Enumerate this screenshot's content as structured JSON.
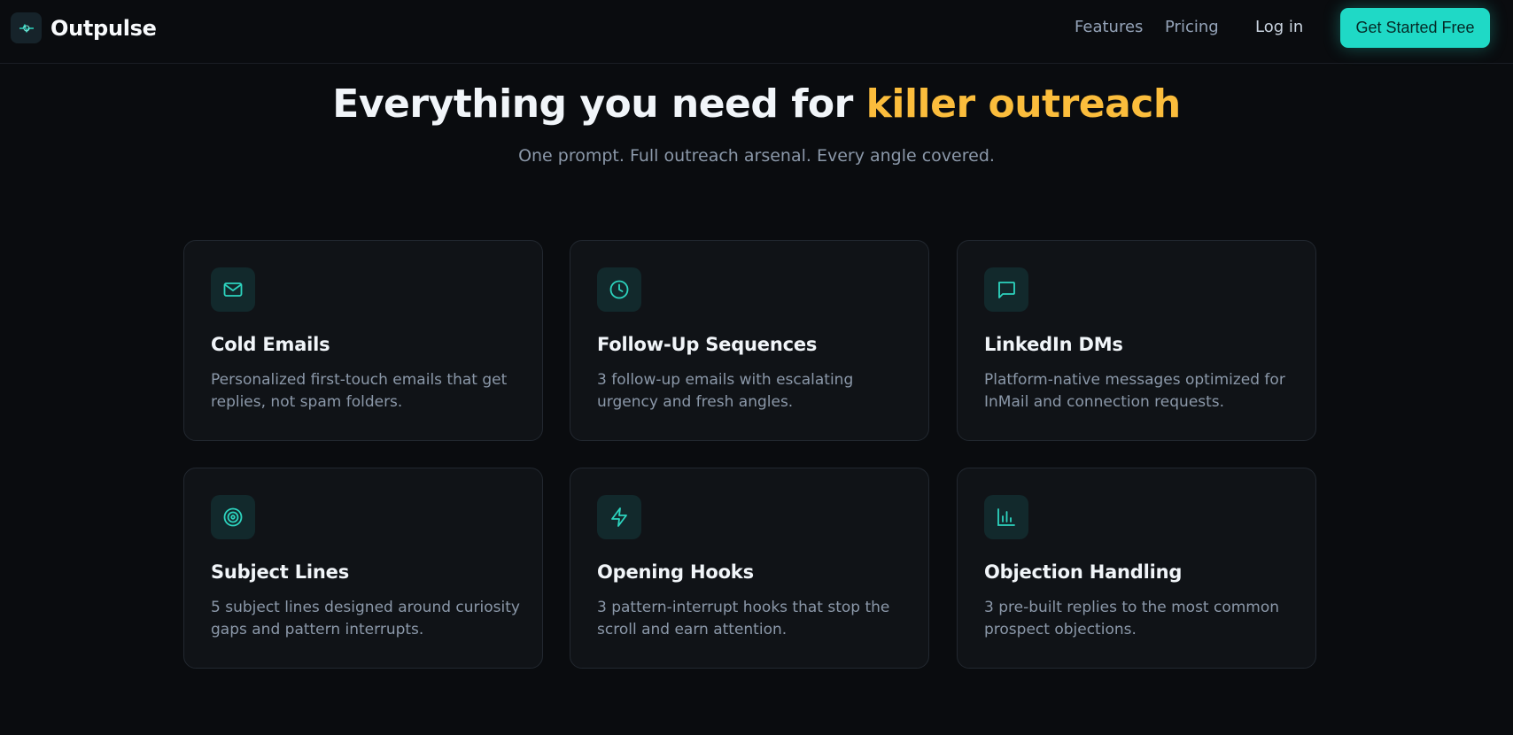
{
  "brand": {
    "name": "Outpulse",
    "logo_icon": "pulse-icon"
  },
  "nav": {
    "links": [
      "Features",
      "Pricing"
    ],
    "login": "Log in",
    "cta": "Get Started Free"
  },
  "hero": {
    "title_main": "Everything you need for ",
    "title_accent": "killer outreach",
    "subtitle": "One prompt. Full outreach arsenal. Every angle covered."
  },
  "features": [
    {
      "icon": "mail-icon",
      "title": "Cold Emails",
      "description": "Personalized first-touch emails that get replies, not spam folders."
    },
    {
      "icon": "clock-icon",
      "title": "Follow-Up Sequences",
      "description": "3 follow-up emails with escalating urgency and fresh angles."
    },
    {
      "icon": "message-icon",
      "title": "LinkedIn DMs",
      "description": "Platform-native messages optimized for InMail and connection requests."
    },
    {
      "icon": "target-icon",
      "title": "Subject Lines",
      "description": "5 subject lines designed around curiosity gaps and pattern interrupts."
    },
    {
      "icon": "lightning-icon",
      "title": "Opening Hooks",
      "description": "3 pattern-interrupt hooks that stop the scroll and earn attention."
    },
    {
      "icon": "bar-chart-icon",
      "title": "Objection Handling",
      "description": "3 pre-built replies to the most common prospect objections."
    }
  ],
  "colors": {
    "background": "#0a0c0f",
    "accent_teal": "#1fd9c6",
    "accent_amber": "#fbbd3c",
    "card_bg": "#101317"
  }
}
